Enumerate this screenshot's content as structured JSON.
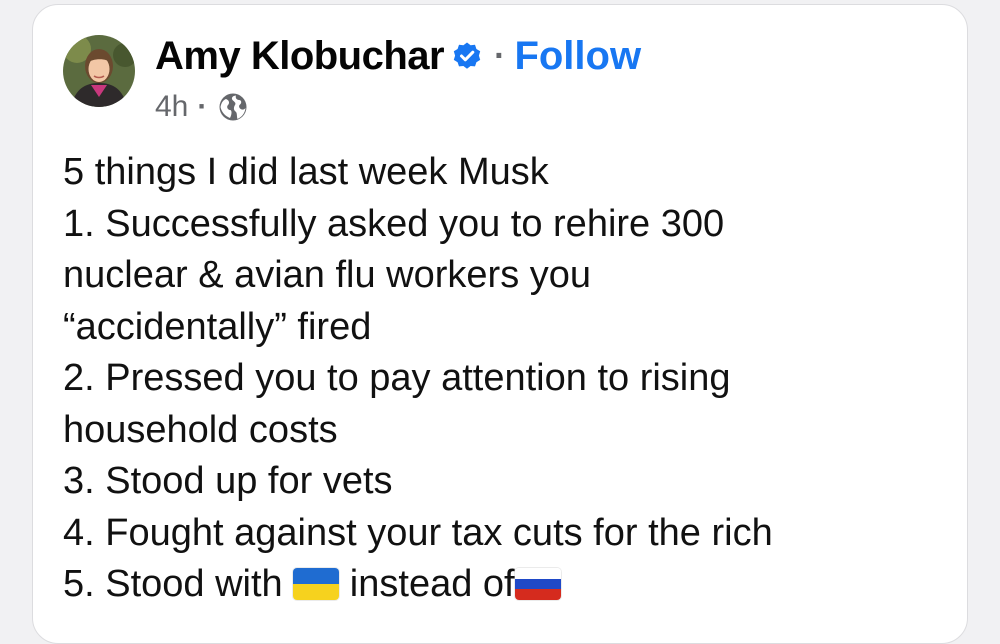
{
  "post": {
    "author": {
      "name": "Amy Klobuchar",
      "verified": true,
      "follow_separator": "·",
      "follow_label": "Follow"
    },
    "meta": {
      "time": "4h",
      "separator": "·",
      "audience_icon": "globe-icon"
    },
    "body": {
      "line1": "5 things I did last week Musk",
      "line2": "1. Successfully asked you to rehire 300",
      "line3": "nuclear & avian flu workers you",
      "line4": "“accidentally” fired",
      "line5": "2. Pressed you to pay attention to rising",
      "line6": "household costs",
      "line7": "3. Stood up for vets",
      "line8": "4. Fought against your tax cuts for the rich",
      "line9_prefix": "5. Stood with ",
      "line9_middle": " instead of",
      "flag_1": "ukraine-flag-emoji",
      "flag_2": "russia-flag-emoji"
    }
  },
  "colors": {
    "background": "#f1f1f3",
    "card": "#ffffff",
    "link": "#1877f2",
    "secondary_text": "#65676b",
    "verified_badge": "#1877f2"
  }
}
